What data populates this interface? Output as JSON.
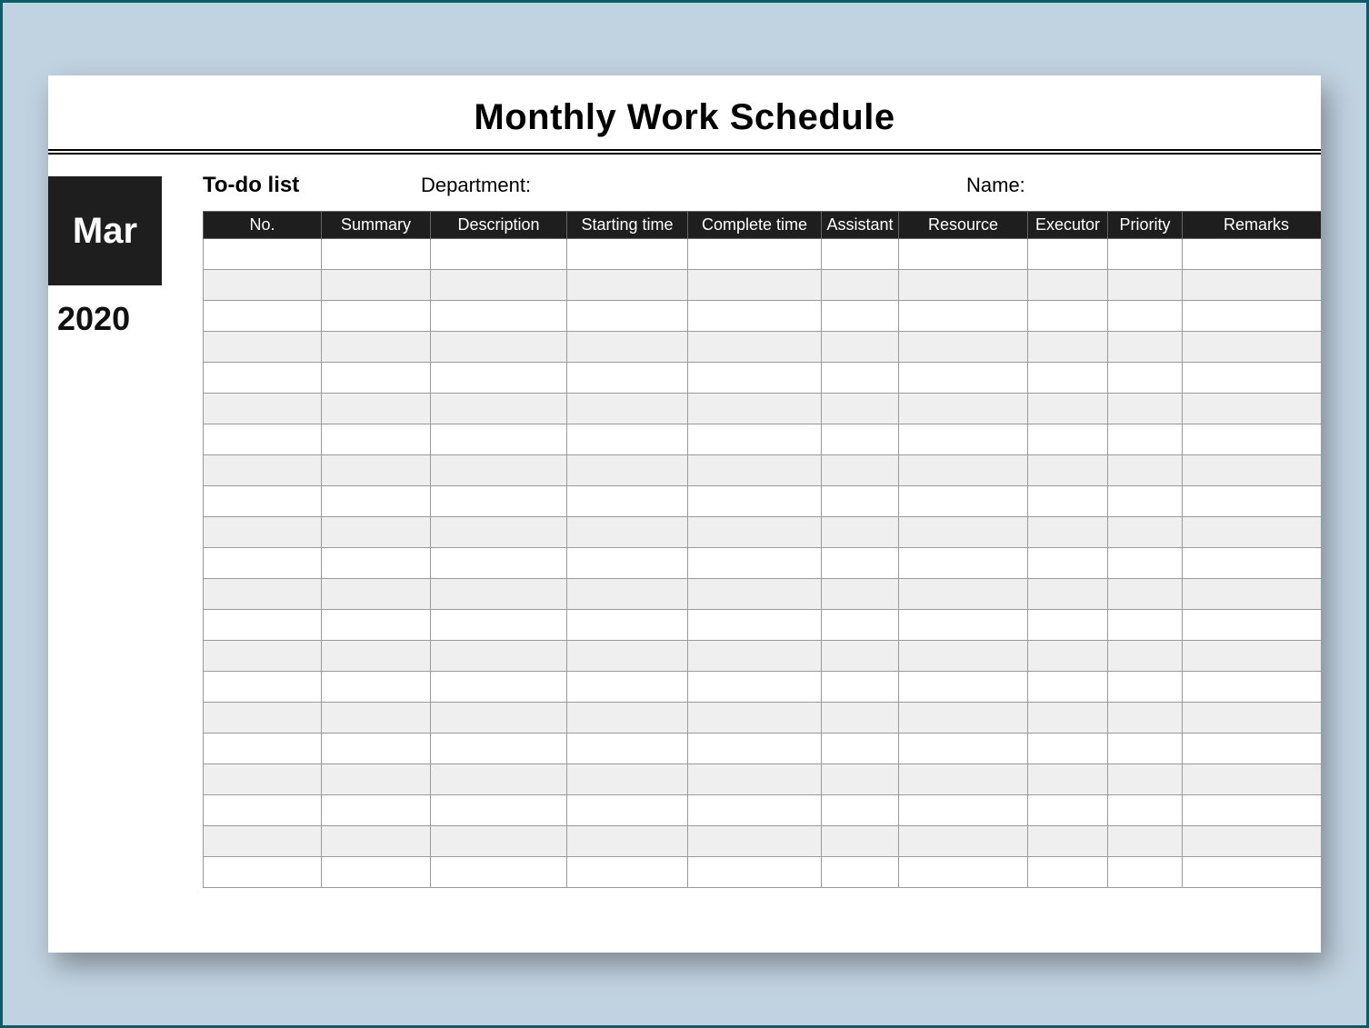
{
  "title": "Monthly Work Schedule",
  "side": {
    "month": "Mar",
    "year": "2020"
  },
  "labels": {
    "todo": "To-do list",
    "department": "Department:",
    "name": "Name:"
  },
  "columns": [
    "No.",
    "Summary",
    "Description",
    "Starting time",
    "Complete time",
    "Assistant",
    "Resource",
    "Executor",
    "Priority",
    "Remarks"
  ],
  "row_count": 21
}
